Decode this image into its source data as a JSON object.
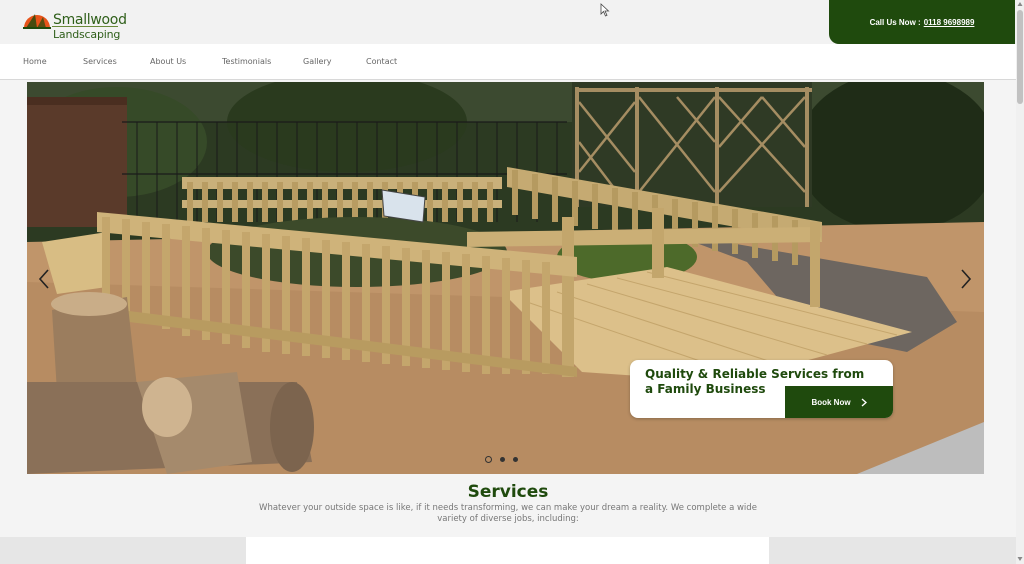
{
  "brand": {
    "line1": "Smallwood",
    "line2": "Landscaping",
    "accent": "#1f4a0d",
    "sun_color": "#e8541a"
  },
  "call": {
    "label": "Call Us Now :",
    "phone": "0118 9698989"
  },
  "nav": [
    {
      "label": "Home"
    },
    {
      "label": "Services"
    },
    {
      "label": "About Us"
    },
    {
      "label": "Testimonials"
    },
    {
      "label": "Gallery"
    },
    {
      "label": "Contact"
    }
  ],
  "hero": {
    "cta_title": "Quality & Reliable Services from a Family Business",
    "cta_button": "Book Now",
    "slide_count": 3,
    "active_slide": 1
  },
  "services": {
    "title": "Services",
    "description": "Whatever your outside space is like, if it needs transforming, we can make your dream a reality. We complete a wide variety of diverse jobs, including:"
  }
}
